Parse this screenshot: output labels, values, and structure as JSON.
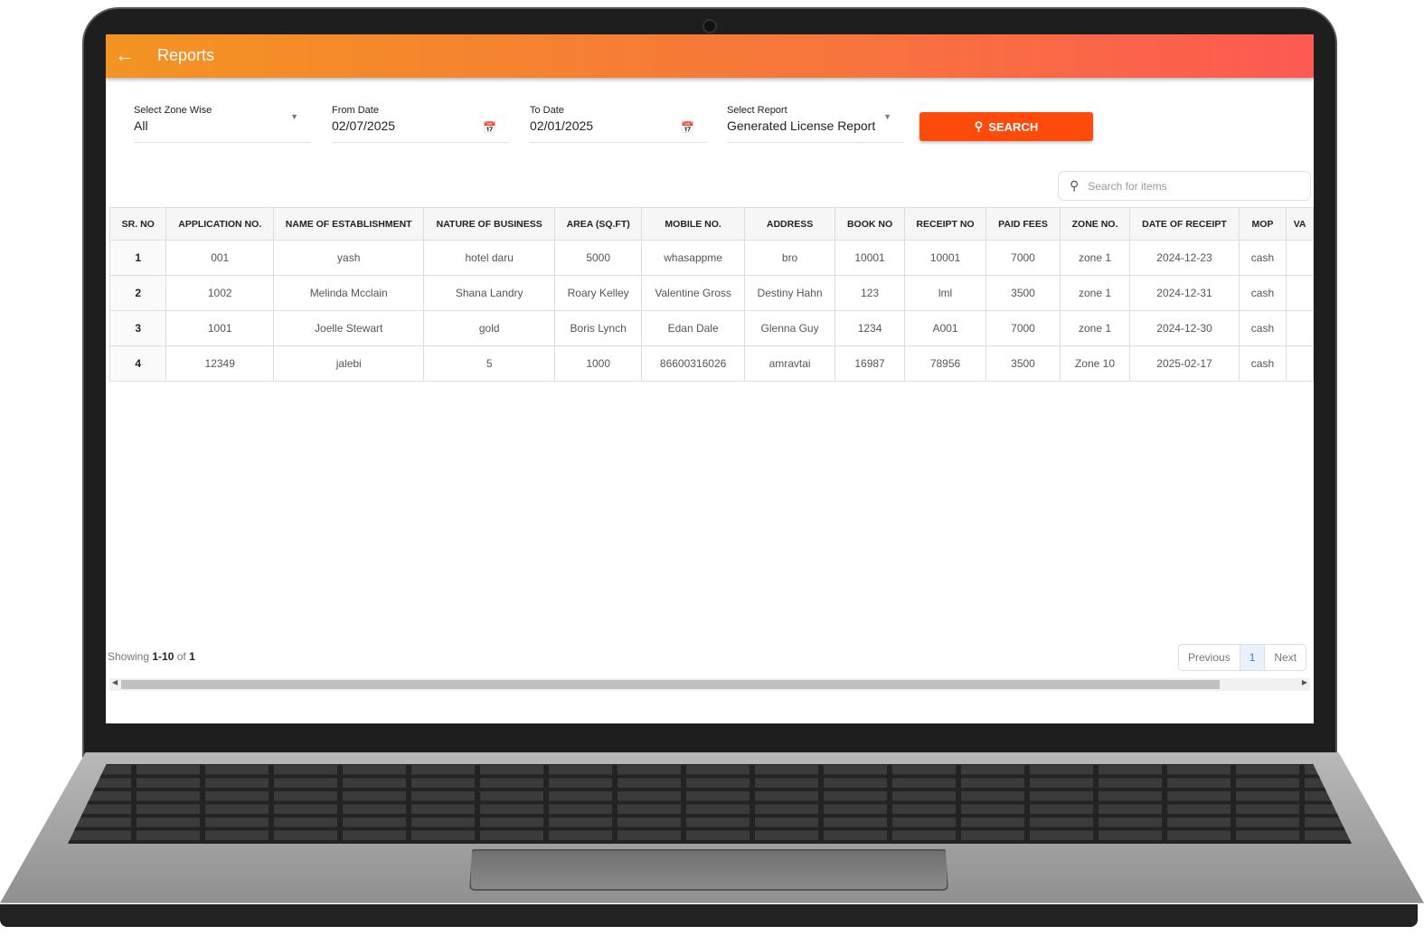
{
  "appbar": {
    "title": "Reports",
    "back_icon": "arrow-left-icon",
    "gradient": [
      "#f39422",
      "#fd5a52"
    ]
  },
  "filters": {
    "zone": {
      "label": "Select Zone Wise",
      "value": "All"
    },
    "from": {
      "label": "From Date",
      "value": "02/07/2025"
    },
    "to": {
      "label": "To Date",
      "value": "02/01/2025"
    },
    "report": {
      "label": "Select Report",
      "value": "Generated License Report"
    },
    "search_label": "SEARCH",
    "accent": "#fe4a0a"
  },
  "table_search": {
    "placeholder": "Search for items"
  },
  "table": {
    "headers": [
      "SR. NO",
      "APPLICATION NO.",
      "NAME OF ESTABLISHMENT",
      "NATURE OF BUSINESS",
      "AREA (SQ.FT)",
      "MOBILE NO.",
      "ADDRESS",
      "BOOK NO",
      "RECEIPT NO",
      "PAID FEES",
      "ZONE NO.",
      "DATE OF RECEIPT",
      "MOP",
      "VA"
    ],
    "rows": [
      [
        "1",
        "001",
        "yash",
        "hotel daru",
        "5000",
        "whasappme",
        "bro",
        "10001",
        "10001",
        "7000",
        "zone 1",
        "2024-12-23",
        "cash",
        ""
      ],
      [
        "2",
        "1002",
        "Melinda Mcclain",
        "Shana Landry",
        "Roary Kelley",
        "Valentine Gross",
        "Destiny Hahn",
        "123",
        "lml",
        "3500",
        "zone 1",
        "2024-12-31",
        "cash",
        ""
      ],
      [
        "3",
        "1001",
        "Joelle Stewart",
        "gold",
        "Boris Lynch",
        "Edan Dale",
        "Glenna Guy",
        "1234",
        "A001",
        "7000",
        "zone 1",
        "2024-12-30",
        "cash",
        ""
      ],
      [
        "4",
        "12349",
        "jalebi",
        "5",
        "1000",
        "86600316026",
        "amravtai",
        "16987",
        "78956",
        "3500",
        "Zone 10",
        "2025-02-17",
        "cash",
        ""
      ]
    ]
  },
  "footer": {
    "showing_prefix": "Showing",
    "range": "1-10",
    "of": "of",
    "total": "1",
    "prev": "Previous",
    "page": "1",
    "next": "Next"
  }
}
